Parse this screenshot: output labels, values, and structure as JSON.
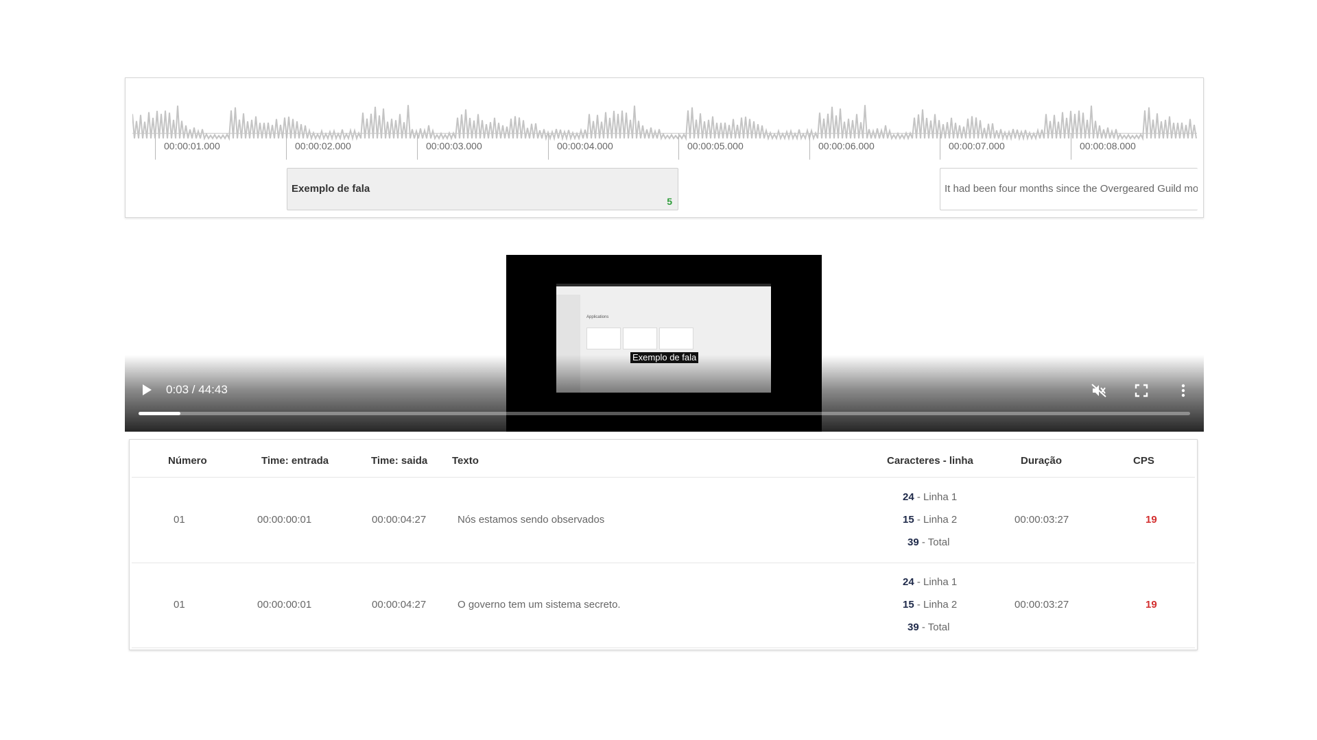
{
  "timeline": {
    "ticks": [
      "00:00:01.000",
      "00:00:02.000",
      "00:00:03.000",
      "00:00:04.000",
      "00:00:05.000",
      "00:00:06.000",
      "00:00:07.000",
      "00:00:08.000"
    ],
    "regions": [
      {
        "text": "Exemplo de fala",
        "count": "5"
      },
      {
        "text": "It had been four months since the Overgeared Guild mo"
      }
    ]
  },
  "player": {
    "time": "0:03 / 44:43",
    "subtitle": "Exemplo de fala",
    "progress_fraction": 0.04,
    "screen_title": "Applications",
    "icons": {
      "play": "play-icon",
      "mute": "volume-muted-icon",
      "fullscreen": "fullscreen-icon",
      "more": "more-vertical-icon"
    }
  },
  "table": {
    "headers": {
      "numero": "Número",
      "entrada": "Time: entrada",
      "saida": "Time: saida",
      "texto": "Texto",
      "caracteres": "Caracteres - linha",
      "duracao": "Duração",
      "cps": "CPS"
    },
    "rows": [
      {
        "numero": "01",
        "entrada": "00:00:00:01",
        "saida": "00:00:04:27",
        "texto": "Nós estamos sendo observados",
        "l1_count": "24",
        "l1_label": " - Linha 1",
        "l2_count": "15",
        "l2_label": " - Linha 2",
        "total_count": "39",
        "total_label": " - Total",
        "duracao": "00:00:03:27",
        "cps": "19"
      },
      {
        "numero": "01",
        "entrada": "00:00:00:01",
        "saida": "00:00:04:27",
        "texto": "O governo tem um sistema secreto.",
        "l1_count": "24",
        "l1_label": " - Linha 1",
        "l2_count": "15",
        "l2_label": " - Linha 2",
        "total_count": "39",
        "total_label": " - Total",
        "duracao": "00:00:03:27",
        "cps": "19"
      }
    ]
  },
  "colors": {
    "cps": "#d32f2f",
    "count_green": "#2e9d3a",
    "char_bold": "#1f2a4a"
  }
}
